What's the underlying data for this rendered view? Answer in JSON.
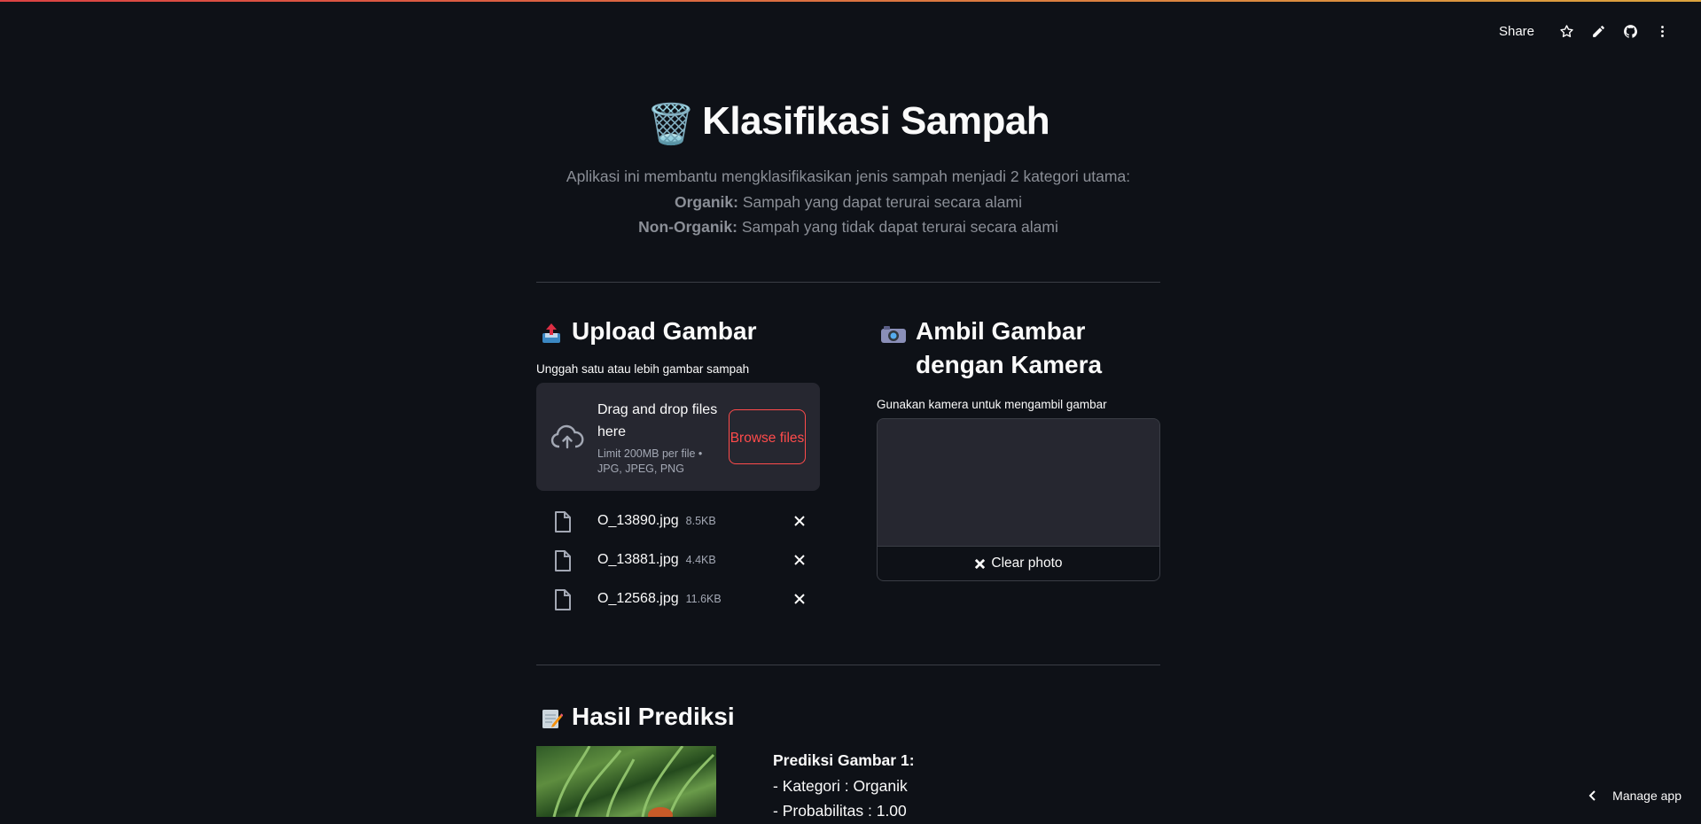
{
  "toolbar": {
    "share_label": "Share",
    "icons": [
      "star-icon",
      "pencil-icon",
      "github-icon",
      "more-vertical-icon"
    ]
  },
  "header": {
    "emoji": "🗑️",
    "title": "Klasifikasi Sampah",
    "description_line1": "Aplikasi ini membantu mengklasifikasikan jenis sampah menjadi 2 kategori utama:",
    "organik_label": "Organik:",
    "organik_text": " Sampah yang dapat terurai secara alami",
    "nonorganik_label": "Non-Organik:",
    "nonorganik_text": " Sampah yang tidak dapat terurai secara alami"
  },
  "upload": {
    "emoji": "📤",
    "heading": "Upload Gambar",
    "label": "Unggah satu atau lebih gambar sampah",
    "drop_title": "Drag and drop files here",
    "drop_limit": "Limit 200MB per file • JPG, JPEG, PNG",
    "browse_label": "Browse files",
    "files": [
      {
        "name": "O_13890.jpg",
        "size": "8.5KB"
      },
      {
        "name": "O_13881.jpg",
        "size": "4.4KB"
      },
      {
        "name": "O_12568.jpg",
        "size": "11.6KB"
      }
    ]
  },
  "camera": {
    "emoji": "📷",
    "heading": "Ambil Gambar dengan Kamera",
    "label": "Gunakan kamera untuk mengambil gambar",
    "clear_label": "Clear photo"
  },
  "prediction": {
    "emoji": "📝",
    "heading": "Hasil Prediksi",
    "title": "Prediksi Gambar 1:",
    "category": "- Kategori : Organik",
    "probability": "- Probabilitas : 1.00"
  },
  "footer": {
    "manage_label": "Manage app"
  },
  "colors": {
    "background": "#0e1117",
    "panel": "#262730",
    "accent": "#ff4b4b",
    "muted_text": "#8b8f97"
  }
}
